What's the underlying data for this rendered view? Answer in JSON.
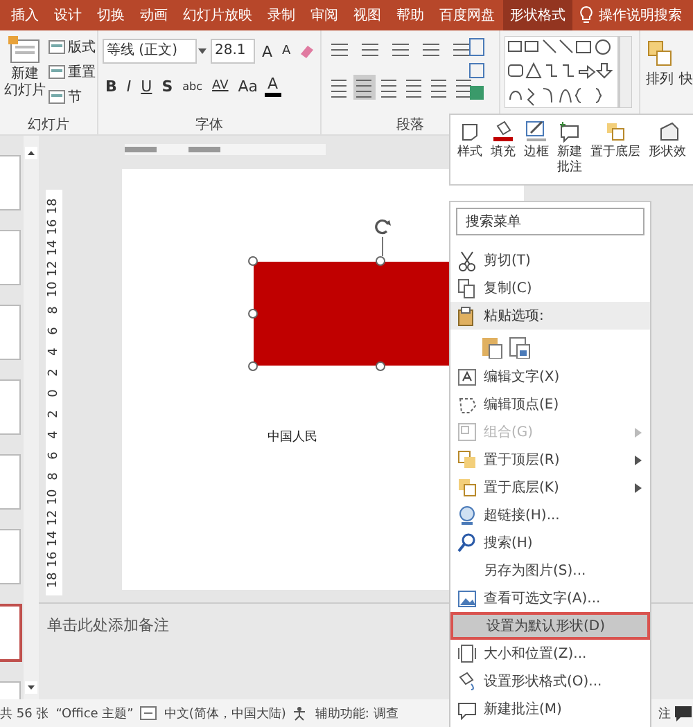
{
  "ribbon_tabs": [
    {
      "label": "插入",
      "selected": false
    },
    {
      "label": "设计",
      "selected": false
    },
    {
      "label": "切换",
      "selected": false
    },
    {
      "label": "动画",
      "selected": false
    },
    {
      "label": "幻灯片放映",
      "selected": false
    },
    {
      "label": "录制",
      "selected": false
    },
    {
      "label": "审阅",
      "selected": false
    },
    {
      "label": "视图",
      "selected": false
    },
    {
      "label": "帮助",
      "selected": false
    },
    {
      "label": "百度网盘",
      "selected": false
    },
    {
      "label": "形状格式",
      "selected": true
    }
  ],
  "tell_me": "操作说明搜索",
  "ribbon": {
    "slides_group": {
      "label": "幻灯片",
      "new_slide": [
        "新建",
        "幻灯片"
      ],
      "layout": "版式",
      "reset": "重置",
      "section": "节"
    },
    "font_group": {
      "label": "字体",
      "font_name": "等线 (正文)",
      "font_size": "28.1",
      "size_buttons": [
        "A",
        "A"
      ],
      "format_buttons": [
        "B",
        "I",
        "U",
        "S",
        "abc",
        "AV",
        "Aa",
        "A"
      ]
    },
    "paragraph_group": {
      "label": "段落"
    },
    "arrange": "排列",
    "quick": "快"
  },
  "mini_toolbar": [
    "样式",
    "填充",
    "边框",
    "新建批注",
    "置于底层",
    "形状效"
  ],
  "slides": [
    {
      "selected": false
    },
    {
      "selected": false
    },
    {
      "selected": false
    },
    {
      "selected": false
    },
    {
      "selected": false
    },
    {
      "selected": false
    },
    {
      "selected": true
    },
    {
      "selected": false
    }
  ],
  "vertical_ruler": [
    "18",
    "16",
    "14",
    "12",
    "10",
    "8",
    "6",
    "4",
    "2",
    "0",
    "2",
    "4",
    "6",
    "8",
    "10",
    "12",
    "14",
    "16",
    "18"
  ],
  "slide": {
    "text": "中国人民"
  },
  "notes": {
    "placeholder": "单击此处添加备注"
  },
  "context_menu": {
    "search": {
      "placeholder": "搜索菜单"
    },
    "items": [
      {
        "kind": "command",
        "label": "剪切(T)",
        "disabled": false,
        "submenu": false,
        "selected": false
      },
      {
        "kind": "command",
        "label": "复制(C)",
        "disabled": false,
        "submenu": false,
        "selected": false
      },
      {
        "kind": "header",
        "label": "粘贴选项:"
      },
      {
        "kind": "paste_options"
      },
      {
        "kind": "command",
        "label": "编辑文字(X)",
        "disabled": false,
        "submenu": false,
        "selected": false
      },
      {
        "kind": "command",
        "label": "编辑顶点(E)",
        "disabled": false,
        "submenu": false,
        "selected": false
      },
      {
        "kind": "command",
        "label": "组合(G)",
        "disabled": true,
        "submenu": true,
        "selected": false
      },
      {
        "kind": "command",
        "label": "置于顶层(R)",
        "disabled": false,
        "submenu": true,
        "selected": false
      },
      {
        "kind": "command",
        "label": "置于底层(K)",
        "disabled": false,
        "submenu": true,
        "selected": false
      },
      {
        "kind": "command",
        "label": "超链接(H)...",
        "disabled": false,
        "submenu": false,
        "selected": false
      },
      {
        "kind": "command",
        "label": "搜索(H)",
        "disabled": false,
        "submenu": false,
        "selected": false
      },
      {
        "kind": "command",
        "label": "另存为图片(S)...",
        "disabled": false,
        "submenu": false,
        "selected": false
      },
      {
        "kind": "command",
        "label": "查看可选文字(A)...",
        "disabled": false,
        "submenu": false,
        "selected": false
      },
      {
        "kind": "command",
        "label": "设置为默认形状(D)",
        "disabled": false,
        "submenu": false,
        "selected": true
      },
      {
        "kind": "command",
        "label": "大小和位置(Z)...",
        "disabled": false,
        "submenu": false,
        "selected": false
      },
      {
        "kind": "command",
        "label": "设置形状格式(O)...",
        "disabled": false,
        "submenu": false,
        "selected": false
      },
      {
        "kind": "command",
        "label": "新建批注(M)",
        "disabled": false,
        "submenu": false,
        "selected": false
      }
    ]
  },
  "status_bar": {
    "slide_count": "共 56 张",
    "theme": "“Office 主题”",
    "language": "中文(简体，中国大陆)",
    "accessibility": "辅助功能: 调查",
    "notes": "注"
  }
}
